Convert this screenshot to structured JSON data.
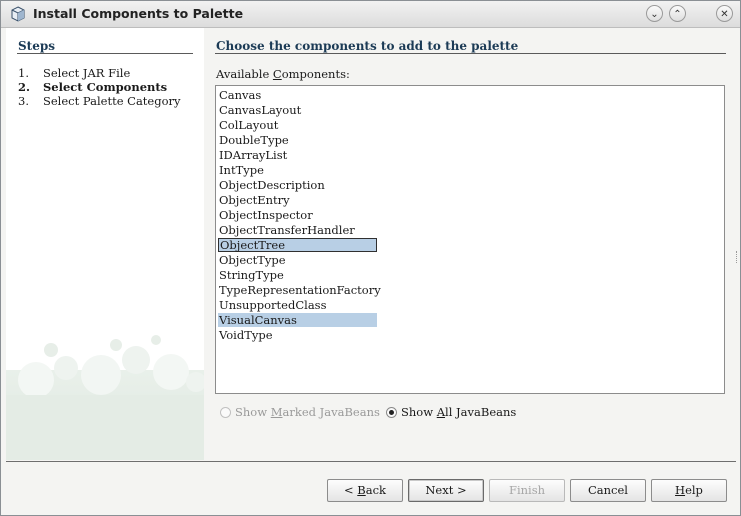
{
  "window": {
    "title": "Install Components to Palette"
  },
  "steps": {
    "title": "Steps",
    "items": [
      {
        "num": "1.",
        "label": "Select JAR File"
      },
      {
        "num": "2.",
        "label": "Select Components"
      },
      {
        "num": "3.",
        "label": "Select Palette Category"
      }
    ]
  },
  "main": {
    "title": "Choose the components to add to the palette",
    "available_label": {
      "before": "Available ",
      "mnemonic": "C",
      "after": "omponents:"
    }
  },
  "components": [
    {
      "name": "Canvas"
    },
    {
      "name": "CanvasLayout"
    },
    {
      "name": "ColLayout"
    },
    {
      "name": "DoubleType"
    },
    {
      "name": "IDArrayList"
    },
    {
      "name": "IntType"
    },
    {
      "name": "ObjectDescription"
    },
    {
      "name": "ObjectEntry"
    },
    {
      "name": "ObjectInspector"
    },
    {
      "name": "ObjectTransferHandler"
    },
    {
      "name": "ObjectTree",
      "selected": true,
      "focused": true
    },
    {
      "name": "ObjectType"
    },
    {
      "name": "StringType"
    },
    {
      "name": "TypeRepresentationFactory"
    },
    {
      "name": "UnsupportedClass"
    },
    {
      "name": "VisualCanvas",
      "selected": true
    },
    {
      "name": "VoidType"
    }
  ],
  "filter": {
    "marked": {
      "before": "Show ",
      "mnemonic": "M",
      "after": "arked JavaBeans",
      "checked": false,
      "enabled": false
    },
    "all": {
      "before": "Show ",
      "mnemonic": "A",
      "after": "ll JavaBeans",
      "checked": true,
      "enabled": true
    }
  },
  "buttons": {
    "back": {
      "before": "< ",
      "mnemonic": "B",
      "after": "ack"
    },
    "next": "Next >",
    "finish": "Finish",
    "cancel": "Cancel",
    "help": {
      "mnemonic": "H",
      "after": "elp"
    }
  },
  "colors": {
    "selection": "#b8cfe5",
    "heading": "#1b3a55"
  }
}
